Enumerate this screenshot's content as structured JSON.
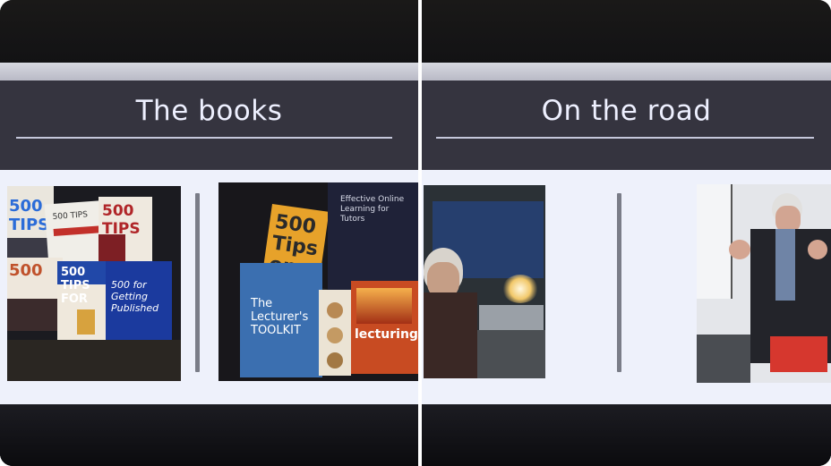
{
  "slides": {
    "left": {
      "title": "The books"
    },
    "right": {
      "title": "On the road"
    }
  },
  "book_covers": {
    "tips_1": "500 TIPS",
    "tips_2": "500 TIPS",
    "tips_3": "500 TIPS",
    "tips_4": "500",
    "tips_5": "500 TIPS FOR",
    "getting_published": "500 for Getting Published",
    "tips_assessment": "500 Tips on Assessment",
    "lecturers_toolkit": "The Lecturer's TOOLKIT",
    "lecturing": "lecturing",
    "online_learning": "Effective Online Learning for Tutors"
  },
  "colors": {
    "slide_header": "#35343f",
    "slide_body": "#eef1fb",
    "title_text": "#eef0ff"
  }
}
